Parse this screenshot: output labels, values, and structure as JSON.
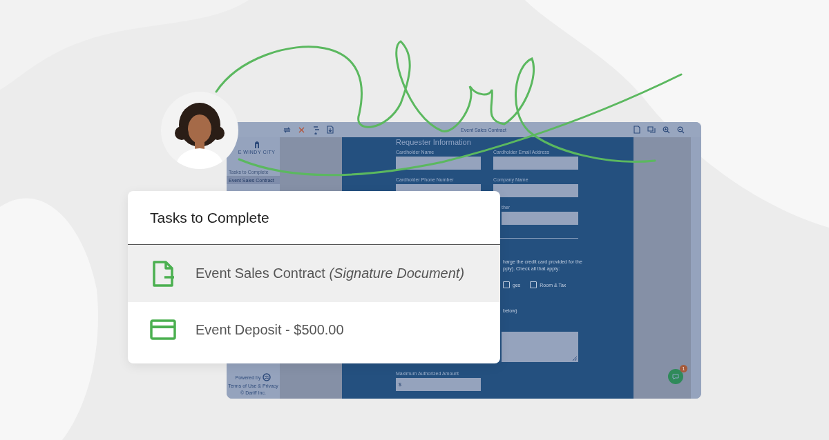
{
  "app_window": {
    "title": "Event Sales Contract",
    "sidebar": {
      "logo_text": "E WINDY CITY",
      "heading": "Tasks to Complete",
      "items": [
        {
          "label": "Event Sales Contract",
          "selected": true
        }
      ],
      "powered_by": "Powered by",
      "terms": "Terms of Use & Privacy",
      "copyright": "© Dariff Inc."
    },
    "document": {
      "section_title": "Requester Information",
      "fields": [
        {
          "label": "Cardholder Name"
        },
        {
          "label": "Cardholder Email Address"
        },
        {
          "label": "Cardholder Phone Number"
        },
        {
          "label": "Company Name"
        },
        {
          "label": "ther"
        }
      ],
      "paragraph": [
        "harge the credit card provided for the",
        "pply). Check all that apply:"
      ],
      "options": [
        {
          "label": "ges",
          "checked": false
        },
        {
          "label": "Room & Tax",
          "checked": false
        }
      ],
      "note": "below)",
      "amount": {
        "label": "Maximum Authorized Amount",
        "placeholder": "$"
      }
    },
    "chat": {
      "badge": "1"
    }
  },
  "tasks_card": {
    "title": "Tasks to Complete",
    "tasks": [
      {
        "kind": "document",
        "label": "Event Sales Contract *(Signature Document)*",
        "selected": true
      },
      {
        "kind": "card",
        "label": "Event Deposit - $500.00",
        "selected": false
      }
    ]
  }
}
